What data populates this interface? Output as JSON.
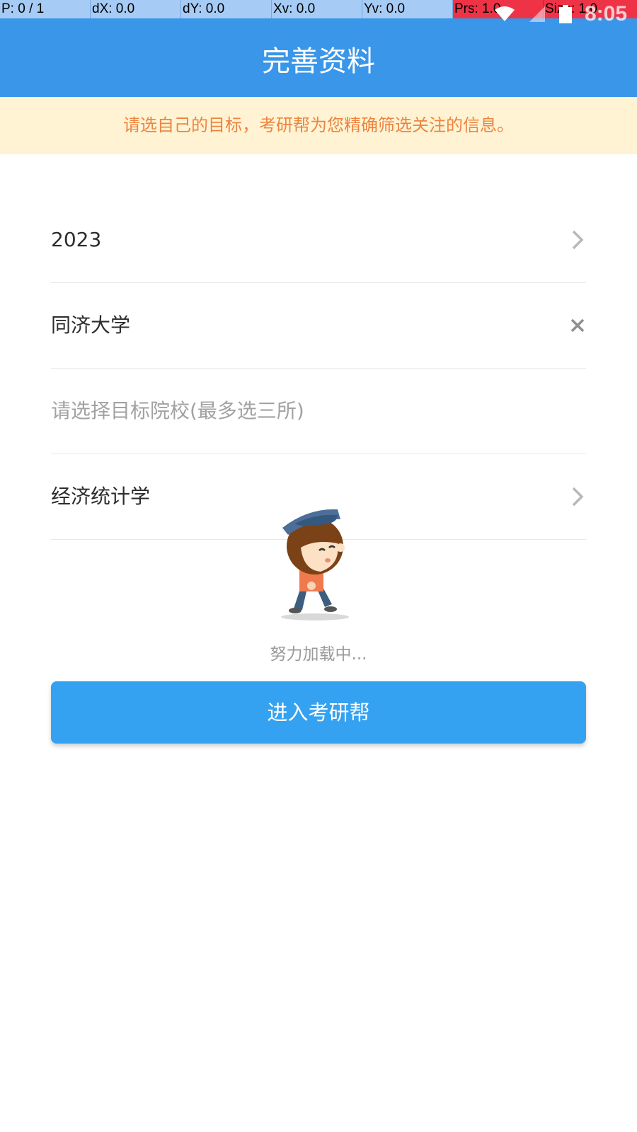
{
  "debug_bar": {
    "cells": [
      "P: 0 / 1",
      "dX: 0.0",
      "dY: 0.0",
      "Xv: 0.0",
      "Yv: 0.0",
      "Prs: 1.0",
      "Size: 1.0"
    ]
  },
  "status_bar": {
    "time": "8:05"
  },
  "header": {
    "title": "完善资料"
  },
  "notice": {
    "text": "请选自己的目标，考研帮为您精确筛选关注的信息。"
  },
  "form": {
    "year": {
      "value": "2023",
      "icon": "chevron-right-icon"
    },
    "school": {
      "value": "同济大学",
      "icon": "close-icon"
    },
    "target_schools": {
      "placeholder": "请选择目标院校(最多选三所)"
    },
    "major": {
      "value": "经济统计学",
      "icon": "chevron-right-icon"
    }
  },
  "loading": {
    "text": "努力加载中..."
  },
  "submit": {
    "label": "进入考研帮"
  },
  "colors": {
    "primary": "#3a96e8",
    "button": "#35a2f1",
    "notice_bg": "#fff3d3",
    "notice_text": "#ec8440"
  }
}
